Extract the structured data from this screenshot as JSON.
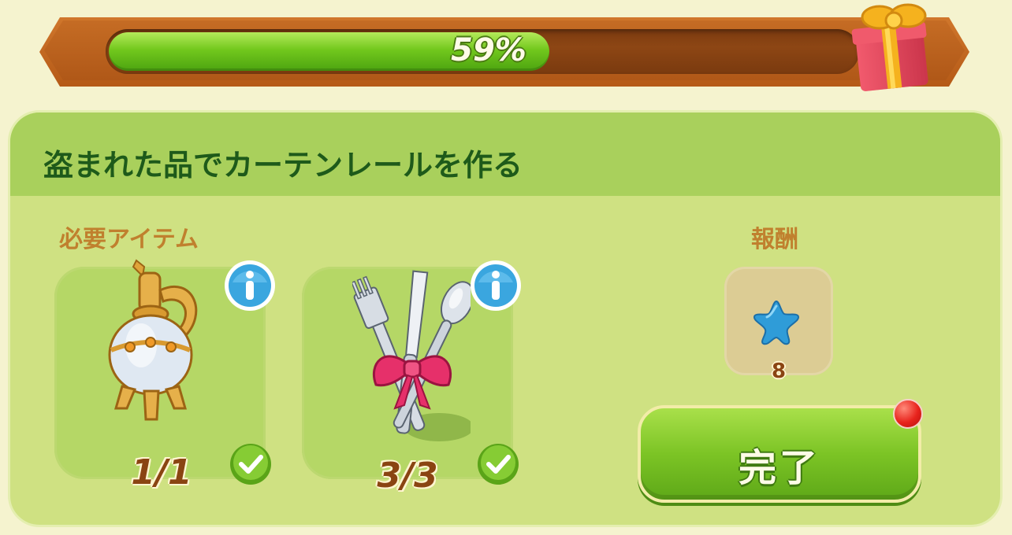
{
  "progress": {
    "value": 0.59,
    "label": "59%",
    "reward_icon": "gift-box-icon"
  },
  "quest": {
    "title": "盗まれた品でカーテンレールを作る",
    "required_label": "必要アイテム",
    "reward_label": "報酬",
    "items": [
      {
        "icon": "golden-pitcher-icon",
        "count": "1/1",
        "info_icon": "info-icon",
        "status_icon": "checkmark-icon"
      },
      {
        "icon": "silverware-with-bow-icon",
        "count": "3/3",
        "info_icon": "info-icon",
        "status_icon": "checkmark-icon"
      }
    ],
    "reward": {
      "icon": "blue-star-icon",
      "amount": "8"
    },
    "complete_label": "完了"
  },
  "colors": {
    "background": "#f5f3cf",
    "panel": "#cfe182",
    "header": "#a9d05c",
    "title_text": "#1e5a1a",
    "progress_fill": "#72c81d",
    "notification": "#e8231c"
  }
}
